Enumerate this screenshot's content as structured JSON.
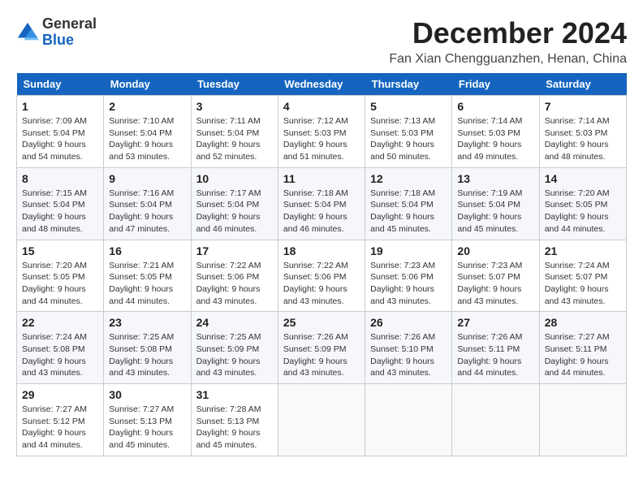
{
  "logo": {
    "general": "General",
    "blue": "Blue"
  },
  "title": "December 2024",
  "location": "Fan Xian Chengguanzhen, Henan, China",
  "days_of_week": [
    "Sunday",
    "Monday",
    "Tuesday",
    "Wednesday",
    "Thursday",
    "Friday",
    "Saturday"
  ],
  "weeks": [
    [
      {
        "day": "1",
        "sunrise": "7:09 AM",
        "sunset": "5:04 PM",
        "daylight": "9 hours and 54 minutes."
      },
      {
        "day": "2",
        "sunrise": "7:10 AM",
        "sunset": "5:04 PM",
        "daylight": "9 hours and 53 minutes."
      },
      {
        "day": "3",
        "sunrise": "7:11 AM",
        "sunset": "5:04 PM",
        "daylight": "9 hours and 52 minutes."
      },
      {
        "day": "4",
        "sunrise": "7:12 AM",
        "sunset": "5:03 PM",
        "daylight": "9 hours and 51 minutes."
      },
      {
        "day": "5",
        "sunrise": "7:13 AM",
        "sunset": "5:03 PM",
        "daylight": "9 hours and 50 minutes."
      },
      {
        "day": "6",
        "sunrise": "7:14 AM",
        "sunset": "5:03 PM",
        "daylight": "9 hours and 49 minutes."
      },
      {
        "day": "7",
        "sunrise": "7:14 AM",
        "sunset": "5:03 PM",
        "daylight": "9 hours and 48 minutes."
      }
    ],
    [
      {
        "day": "8",
        "sunrise": "7:15 AM",
        "sunset": "5:04 PM",
        "daylight": "9 hours and 48 minutes."
      },
      {
        "day": "9",
        "sunrise": "7:16 AM",
        "sunset": "5:04 PM",
        "daylight": "9 hours and 47 minutes."
      },
      {
        "day": "10",
        "sunrise": "7:17 AM",
        "sunset": "5:04 PM",
        "daylight": "9 hours and 46 minutes."
      },
      {
        "day": "11",
        "sunrise": "7:18 AM",
        "sunset": "5:04 PM",
        "daylight": "9 hours and 46 minutes."
      },
      {
        "day": "12",
        "sunrise": "7:18 AM",
        "sunset": "5:04 PM",
        "daylight": "9 hours and 45 minutes."
      },
      {
        "day": "13",
        "sunrise": "7:19 AM",
        "sunset": "5:04 PM",
        "daylight": "9 hours and 45 minutes."
      },
      {
        "day": "14",
        "sunrise": "7:20 AM",
        "sunset": "5:05 PM",
        "daylight": "9 hours and 44 minutes."
      }
    ],
    [
      {
        "day": "15",
        "sunrise": "7:20 AM",
        "sunset": "5:05 PM",
        "daylight": "9 hours and 44 minutes."
      },
      {
        "day": "16",
        "sunrise": "7:21 AM",
        "sunset": "5:05 PM",
        "daylight": "9 hours and 44 minutes."
      },
      {
        "day": "17",
        "sunrise": "7:22 AM",
        "sunset": "5:06 PM",
        "daylight": "9 hours and 43 minutes."
      },
      {
        "day": "18",
        "sunrise": "7:22 AM",
        "sunset": "5:06 PM",
        "daylight": "9 hours and 43 minutes."
      },
      {
        "day": "19",
        "sunrise": "7:23 AM",
        "sunset": "5:06 PM",
        "daylight": "9 hours and 43 minutes."
      },
      {
        "day": "20",
        "sunrise": "7:23 AM",
        "sunset": "5:07 PM",
        "daylight": "9 hours and 43 minutes."
      },
      {
        "day": "21",
        "sunrise": "7:24 AM",
        "sunset": "5:07 PM",
        "daylight": "9 hours and 43 minutes."
      }
    ],
    [
      {
        "day": "22",
        "sunrise": "7:24 AM",
        "sunset": "5:08 PM",
        "daylight": "9 hours and 43 minutes."
      },
      {
        "day": "23",
        "sunrise": "7:25 AM",
        "sunset": "5:08 PM",
        "daylight": "9 hours and 43 minutes."
      },
      {
        "day": "24",
        "sunrise": "7:25 AM",
        "sunset": "5:09 PM",
        "daylight": "9 hours and 43 minutes."
      },
      {
        "day": "25",
        "sunrise": "7:26 AM",
        "sunset": "5:09 PM",
        "daylight": "9 hours and 43 minutes."
      },
      {
        "day": "26",
        "sunrise": "7:26 AM",
        "sunset": "5:10 PM",
        "daylight": "9 hours and 43 minutes."
      },
      {
        "day": "27",
        "sunrise": "7:26 AM",
        "sunset": "5:11 PM",
        "daylight": "9 hours and 44 minutes."
      },
      {
        "day": "28",
        "sunrise": "7:27 AM",
        "sunset": "5:11 PM",
        "daylight": "9 hours and 44 minutes."
      }
    ],
    [
      {
        "day": "29",
        "sunrise": "7:27 AM",
        "sunset": "5:12 PM",
        "daylight": "9 hours and 44 minutes."
      },
      {
        "day": "30",
        "sunrise": "7:27 AM",
        "sunset": "5:13 PM",
        "daylight": "9 hours and 45 minutes."
      },
      {
        "day": "31",
        "sunrise": "7:28 AM",
        "sunset": "5:13 PM",
        "daylight": "9 hours and 45 minutes."
      },
      null,
      null,
      null,
      null
    ]
  ],
  "labels": {
    "sunrise": "Sunrise:",
    "sunset": "Sunset:",
    "daylight": "Daylight:"
  }
}
